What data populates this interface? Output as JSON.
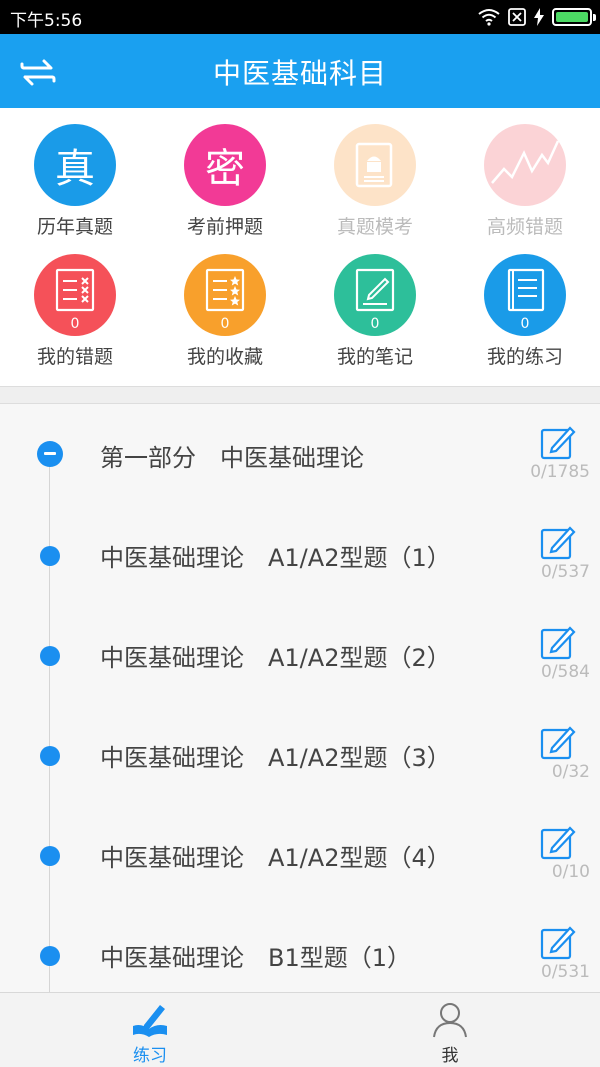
{
  "status_bar": {
    "time": "下午5:56",
    "icons": [
      "wifi-icon",
      "sim-off-icon",
      "charging-icon",
      "battery-icon"
    ]
  },
  "header": {
    "title": "中医基础科目",
    "switch_icon": "switch-arrows-icon",
    "color": "#1aa0f0"
  },
  "grid": {
    "items": [
      {
        "label": "历年真题",
        "glyph": "真",
        "color": "#1a9be8",
        "enabled": true
      },
      {
        "label": "考前押题",
        "glyph": "密",
        "color": "#f23a96",
        "enabled": true
      },
      {
        "label": "真题模考",
        "icon": "android-doc-icon",
        "color": "#fde3c8",
        "enabled": false
      },
      {
        "label": "高频错题",
        "icon": "line-chart-icon",
        "color": "#fbd3d6",
        "enabled": false
      },
      {
        "label": "我的错题",
        "count": "0",
        "icon": "wrong-list-icon",
        "color": "#f55159"
      },
      {
        "label": "我的收藏",
        "count": "0",
        "icon": "star-list-icon",
        "color": "#f8a02c"
      },
      {
        "label": "我的笔记",
        "count": "0",
        "icon": "note-edit-icon",
        "color": "#2dbf9a"
      },
      {
        "label": "我的练习",
        "count": "0",
        "icon": "practice-book-icon",
        "color": "#1a9be8"
      }
    ]
  },
  "chapters": [
    {
      "title": "第一部分　中医基础理论",
      "progress": "0/1785",
      "expanded": true
    },
    {
      "title": "中医基础理论　A1/A2型题（1）",
      "progress": "0/537"
    },
    {
      "title": "中医基础理论　A1/A2型题（2）",
      "progress": "0/584"
    },
    {
      "title": "中医基础理论　A1/A2型题（3）",
      "progress": "0/32"
    },
    {
      "title": "中医基础理论　A1/A2型题（4）",
      "progress": "0/10"
    },
    {
      "title": "中医基础理论　B1型题（1）",
      "progress": "0/531"
    }
  ],
  "tabbar": {
    "tabs": [
      {
        "label": "练习",
        "icon": "pen-book-icon",
        "active": true
      },
      {
        "label": "我",
        "icon": "user-icon",
        "active": false
      }
    ],
    "active_color": "#1a8ff0"
  }
}
